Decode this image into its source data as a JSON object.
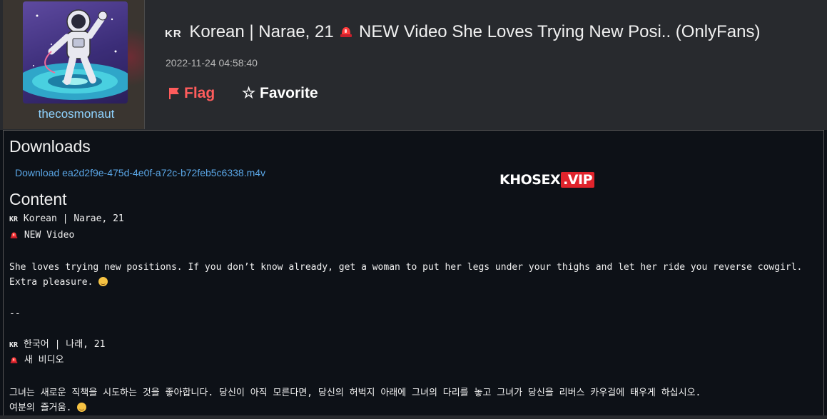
{
  "user": {
    "name": "thecosmonaut"
  },
  "post": {
    "title_flag": "KR",
    "title_text": " Korean | Narae, 21 ",
    "title_rest": " NEW Video She Loves Trying New Posi.. (OnlyFans)",
    "date": "2022-11-24 04:58:40"
  },
  "actions": {
    "flag_label": "Flag",
    "favorite_label": "Favorite"
  },
  "downloads": {
    "heading": "Downloads",
    "items": [
      {
        "label": "Download ea2d2f9e-475d-4e0f-a72c-b72feb5c6338.m4v"
      }
    ]
  },
  "watermark": {
    "brand": "KHOSEX",
    "tld": ".VIP"
  },
  "content": {
    "heading": "Content",
    "lines": [
      {
        "prefix": "KR",
        "text": " Korean | Narae, 21"
      },
      {
        "icon": "siren-icon",
        "text": " NEW Video"
      },
      {
        "text": ""
      },
      {
        "text": "She loves trying new positions. If you don’t know already, get a woman to put her legs under your thighs and let her ride you reverse cowgirl."
      },
      {
        "text": "Extra pleasure. ",
        "emoji": "smirk-emoji"
      },
      {
        "text": ""
      },
      {
        "text": "--"
      },
      {
        "text": ""
      },
      {
        "prefix": "KR",
        "text": " 한국어 | 나래, 21"
      },
      {
        "icon": "siren-icon",
        "text": " 새 비디오"
      },
      {
        "text": ""
      },
      {
        "text": "그녀는 새로운 직책을 시도하는 것을 좋아합니다. 당신이 아직 모른다면, 당신의 허벅지 아래에 그녀의 다리를 놓고 그녀가 당신을 리버스 카우걸에 태우게 하십시오."
      },
      {
        "text": "여분의 즐거움. ",
        "emoji": "smirk-emoji"
      }
    ]
  },
  "colors": {
    "accent_link": "#5aa6e6",
    "flag_red": "#ff5c5c",
    "username": "#8fd3ff"
  }
}
